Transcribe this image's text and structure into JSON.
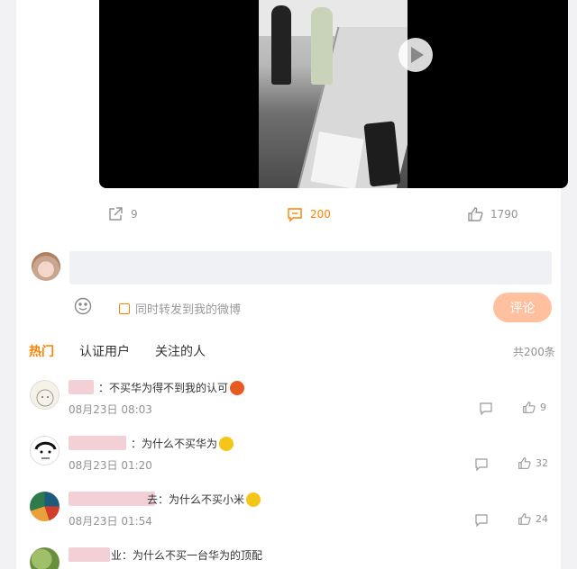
{
  "actions": {
    "share_count": "9",
    "comment_count": "200",
    "like_count": "1790"
  },
  "composer": {
    "input_value": "",
    "forward_label": "同时转发到我的微博",
    "submit_label": "评论"
  },
  "tabs": [
    {
      "label": "热门"
    },
    {
      "label": "认证用户"
    },
    {
      "label": "关注的人"
    }
  ],
  "total_label": "共200条",
  "comments": [
    {
      "text": "：不买华为得不到我的认可",
      "time": "08月23日 08:03",
      "likes": "9"
    },
    {
      "text": "：为什么不买华为",
      "time": "08月23日 01:20",
      "likes": "32"
    },
    {
      "text": "去：为什么不买小米",
      "time": "08月23日 01:54",
      "likes": "24"
    },
    {
      "text": "业：为什么不买一台华为的顶配",
      "time": "",
      "likes": ""
    }
  ],
  "icons": {
    "share": "share-icon",
    "comment": "comment-icon",
    "like": "thumbs-up-icon",
    "emoji": "smiley-icon"
  },
  "colors": {
    "accent": "#ff8200",
    "submit_bg": "#ffc09f"
  }
}
